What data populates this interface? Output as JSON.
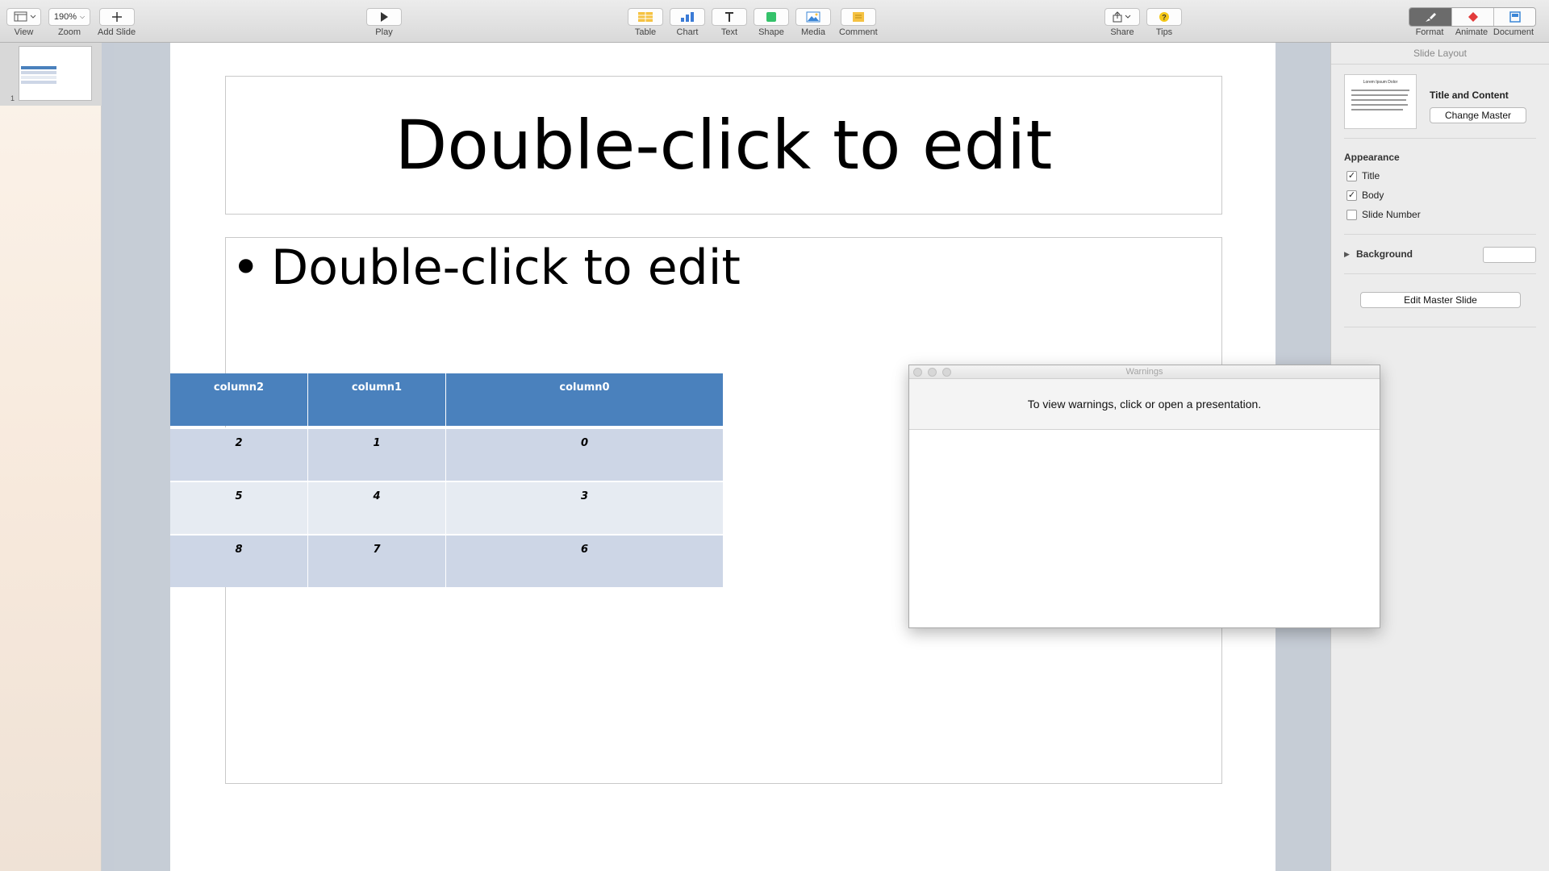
{
  "toolbar": {
    "view_label": "View",
    "zoom_value": "190%",
    "zoom_label": "Zoom",
    "add_slide_label": "Add Slide",
    "play_label": "Play",
    "table_label": "Table",
    "chart_label": "Chart",
    "text_label": "Text",
    "shape_label": "Shape",
    "media_label": "Media",
    "comment_label": "Comment",
    "share_label": "Share",
    "tips_label": "Tips",
    "format_label": "Format",
    "animate_label": "Animate",
    "document_label": "Document"
  },
  "navigator": {
    "slide_number": "1"
  },
  "slide": {
    "title_text": "Double-click to edit",
    "bullet_glyph": "•",
    "body_text": "Double-click to edit",
    "table": {
      "headers": [
        "column2",
        "column1",
        "column0"
      ],
      "rows": [
        [
          "2",
          "1",
          "0"
        ],
        [
          "5",
          "4",
          "3"
        ],
        [
          "8",
          "7",
          "6"
        ]
      ]
    }
  },
  "inspector": {
    "header": "Slide Layout",
    "thumb_title": "Lorem Ipsum Dolor",
    "layout_name": "Title and Content",
    "change_master_label": "Change Master",
    "appearance_title": "Appearance",
    "check_title_label": "Title",
    "check_title_checked": true,
    "check_body_label": "Body",
    "check_body_checked": true,
    "check_slidenum_label": "Slide Number",
    "check_slidenum_checked": false,
    "background_label": "Background",
    "edit_master_label": "Edit Master Slide"
  },
  "warnings": {
    "title": "Warnings",
    "message": "To view warnings, click or open a presentation."
  },
  "colors": {
    "table_header": "#4a81bd",
    "table_row_dark": "#cdd6e6",
    "table_row_light": "#e6ebf2"
  }
}
